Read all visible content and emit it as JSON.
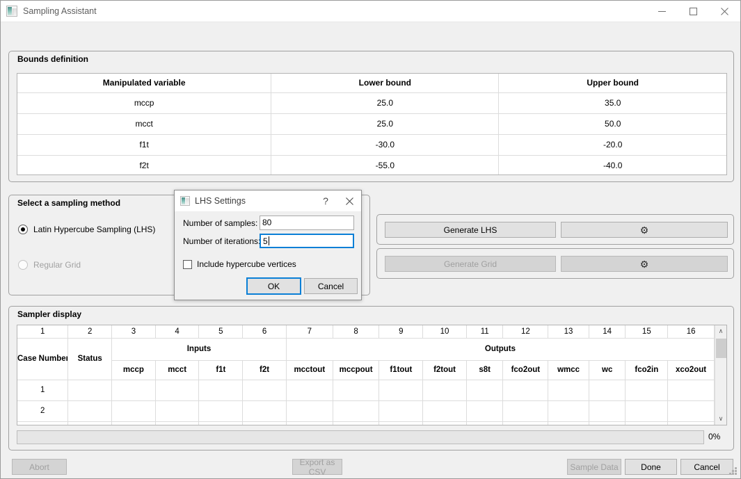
{
  "window": {
    "title": "Sampling Assistant",
    "icon": "app-icon",
    "minimize_label": "—",
    "maximize_label": "☐",
    "close_label": "✕"
  },
  "bounds": {
    "group_title": "Bounds definition",
    "columns": [
      "Manipulated variable",
      "Lower bound",
      "Upper bound"
    ],
    "rows": [
      {
        "variable": "mccp",
        "lower": "25.0",
        "upper": "35.0"
      },
      {
        "variable": "mcct",
        "lower": "25.0",
        "upper": "50.0"
      },
      {
        "variable": "f1t",
        "lower": "-30.0",
        "upper": "-20.0"
      },
      {
        "variable": "f2t",
        "lower": "-55.0",
        "upper": "-40.0"
      }
    ]
  },
  "method": {
    "group_title": "Select a sampling method",
    "options": [
      {
        "label": "Latin Hypercube Sampling (LHS)",
        "selected": true,
        "disabled": false
      },
      {
        "label": "Regular Grid",
        "selected": false,
        "disabled": true
      }
    ]
  },
  "generate": {
    "lhs_button": "Generate LHS",
    "lhs_settings_icon": "gear-icon",
    "lhs_gear_glyph": "⚙",
    "grid_button": "Generate Grid",
    "grid_settings_icon": "gear-icon",
    "grid_gear_glyph": "⚙"
  },
  "sampler": {
    "group_title": "Sampler display",
    "column_numbers": [
      "1",
      "2",
      "3",
      "4",
      "5",
      "6",
      "7",
      "8",
      "9",
      "10",
      "11",
      "12",
      "13",
      "14",
      "15",
      "16"
    ],
    "fixed_headers": [
      "Case Number",
      "Status"
    ],
    "group_headers": [
      {
        "label": "Inputs",
        "span": 4
      },
      {
        "label": "Outputs",
        "span": 10
      }
    ],
    "variable_headers": [
      "mccp",
      "mcct",
      "f1t",
      "f2t",
      "mcctout",
      "mccpout",
      "f1tout",
      "f2tout",
      "s8t",
      "fco2out",
      "wmcc",
      "wc",
      "fco2in",
      "xco2out"
    ],
    "rows": [
      {
        "case_number": "1",
        "status": "",
        "values": [
          "",
          "",
          "",
          "",
          "",
          "",
          "",
          "",
          "",
          "",
          "",
          "",
          "",
          ""
        ]
      },
      {
        "case_number": "2",
        "status": "",
        "values": [
          "",
          "",
          "",
          "",
          "",
          "",
          "",
          "",
          "",
          "",
          "",
          "",
          "",
          ""
        ]
      }
    ],
    "scrollbar": {
      "up_arrow": "∧",
      "down_arrow": "∨"
    }
  },
  "progress": {
    "value": 0,
    "label": "0%"
  },
  "footer": {
    "abort": "Abort",
    "export_csv": "Export as CSV",
    "sample_data": "Sample Data",
    "done": "Done",
    "cancel": "Cancel"
  },
  "dialog": {
    "title": "LHS Settings",
    "icon": "app-icon",
    "help_label": "?",
    "close_label": "✕",
    "samples_label": "Number of samples:",
    "samples_value": "80",
    "iterations_label": "Number of iterations:",
    "iterations_value": "5",
    "checkbox_label": "Include hypercube vertices",
    "checkbox_checked": false,
    "ok_label": "OK",
    "cancel_label": "Cancel"
  },
  "colors": {
    "window_bg": "#f0f0f0",
    "accent_focus": "#0a7fd6",
    "disabled_text": "#a0a0a0",
    "grid_line": "#dcdcdc"
  }
}
